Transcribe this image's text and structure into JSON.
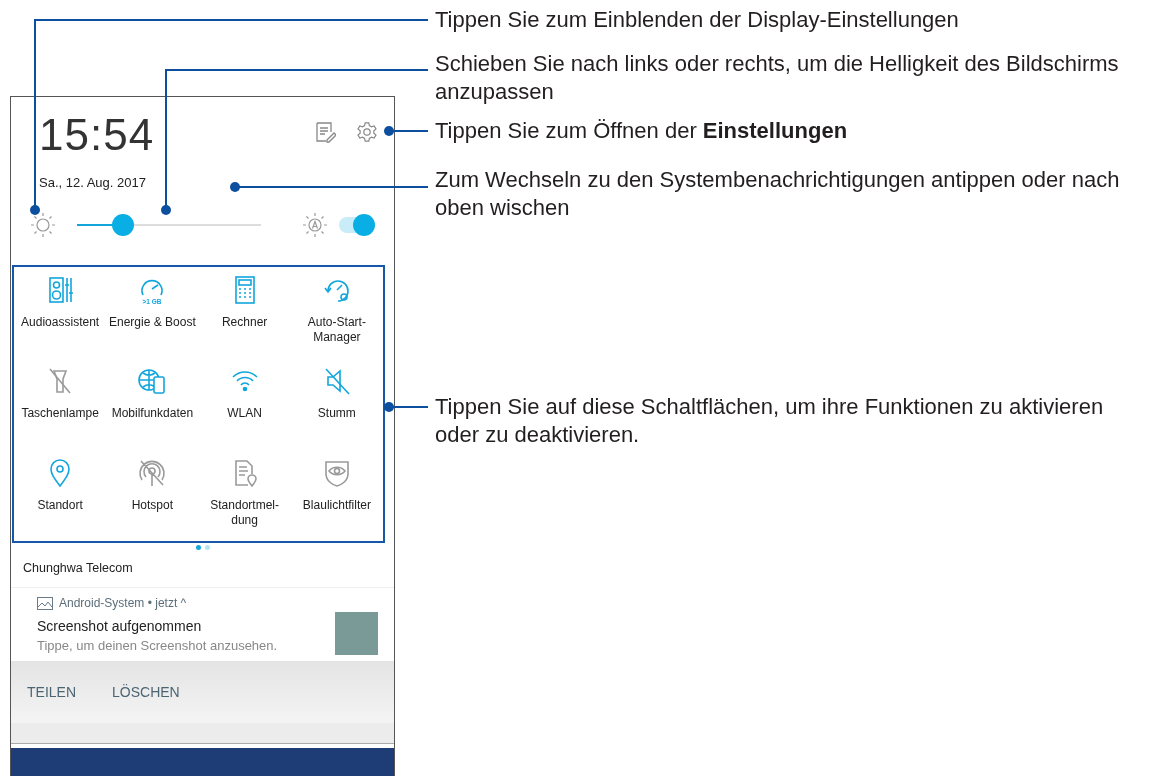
{
  "callouts": [
    {
      "text": "Tippen Sie zum Einblenden der Display-Einstellungen"
    },
    {
      "text": "Schieben Sie nach links oder rechts, um die Helligkeit des Bildschirms anzupassen"
    },
    {
      "text": "Tippen Sie zum Öffnen der **Einstellungen**"
    },
    {
      "text": "Zum Wechseln zu den Systembenachrichtigungen antippen oder nach oben wischen"
    },
    {
      "text": "Tippen Sie auf diese Schaltflächen, um ihre Funktionen zu aktivieren oder zu deaktivieren."
    }
  ],
  "phone": {
    "time": "15:54",
    "date": "Sa., 12. Aug. 2017",
    "brightness": {
      "level": 0.25,
      "auto": true
    },
    "tiles": [
      {
        "label": "Audioassistent",
        "on": true
      },
      {
        "label": "Energie & Boost",
        "on": true,
        "badge": ">1 GB"
      },
      {
        "label": "Rechner",
        "on": true
      },
      {
        "label": "Auto-Start-Manager",
        "on": true
      },
      {
        "label": "Taschenlampe",
        "on": false
      },
      {
        "label": "Mobilfunkdaten",
        "on": true
      },
      {
        "label": "WLAN",
        "on": true
      },
      {
        "label": "Stumm",
        "on": true
      },
      {
        "label": "Standort",
        "on": true
      },
      {
        "label": "Hotspot",
        "on": false
      },
      {
        "label": "Standortmel-dung",
        "on": false
      },
      {
        "label": "Blaulichtfilter",
        "on": false
      }
    ],
    "pages": [
      {
        "selected": true
      },
      {
        "selected": false
      }
    ],
    "carrier": "Chunghwa Telecom",
    "notification": {
      "app": "Android-System",
      "separator": "•",
      "time": "jetzt",
      "caret": "^",
      "title": "Screenshot aufgenommen",
      "body": "Tippe, um deinen Screenshot anzusehen.",
      "actions": [
        "TEILEN",
        "LÖSCHEN"
      ]
    }
  }
}
